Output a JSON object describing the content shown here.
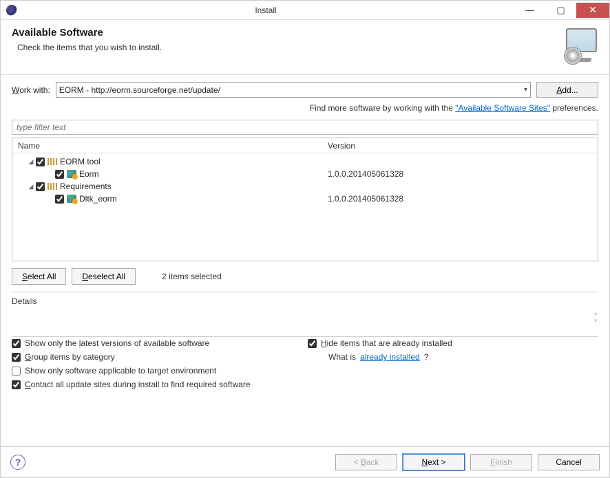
{
  "window": {
    "title": "Install",
    "minimize": "—",
    "maximize": "▢",
    "close": "✕"
  },
  "header": {
    "title": "Available Software",
    "subtitle": "Check the items that you wish to install."
  },
  "workwith": {
    "label_pre": "W",
    "label_post": "ork with:",
    "value": "EORM - http://eorm.sourceforge.net/update/",
    "add_pre": "A",
    "add_post": "dd..."
  },
  "findmore": {
    "prefix": "Find more software by working with the ",
    "link": "Available Software Sites",
    "suffix": " preferences."
  },
  "filter": {
    "placeholder": "type filter text"
  },
  "columns": {
    "name": "Name",
    "version": "Version"
  },
  "tree": [
    {
      "type": "category",
      "checked": true,
      "label": "EORM tool"
    },
    {
      "type": "item",
      "checked": true,
      "label": "Eorm",
      "version": "1.0.0.201405061328"
    },
    {
      "type": "category",
      "checked": true,
      "label": "Requirements"
    },
    {
      "type": "item",
      "checked": true,
      "label": "Dltk_eorm",
      "version": "1.0.0.201405061328"
    }
  ],
  "selection": {
    "select_all_pre": "S",
    "select_all_post": "elect All",
    "deselect_all_pre": "D",
    "deselect_all_post": "eselect All",
    "count": "2 items selected"
  },
  "details": {
    "label": "Details"
  },
  "options": {
    "latest_a": "Show only the ",
    "latest_mn": "l",
    "latest_b": "atest versions of available software",
    "group_mn": "G",
    "group_b": "roup items by category",
    "target": "Show only software applicable to target environment",
    "contact_mn": "C",
    "contact_b": "ontact all update sites during install to find required software",
    "hide_mn": "H",
    "hide_b": "ide items that are already installed",
    "whatis_a": "What is ",
    "whatis_link": "already installed",
    "whatis_b": "?"
  },
  "buttons": {
    "back_pre": "< ",
    "back_mn": "B",
    "back_post": "ack",
    "next_mn": "N",
    "next_post": "ext >",
    "finish_mn": "F",
    "finish_post": "inish",
    "cancel": "Cancel"
  }
}
